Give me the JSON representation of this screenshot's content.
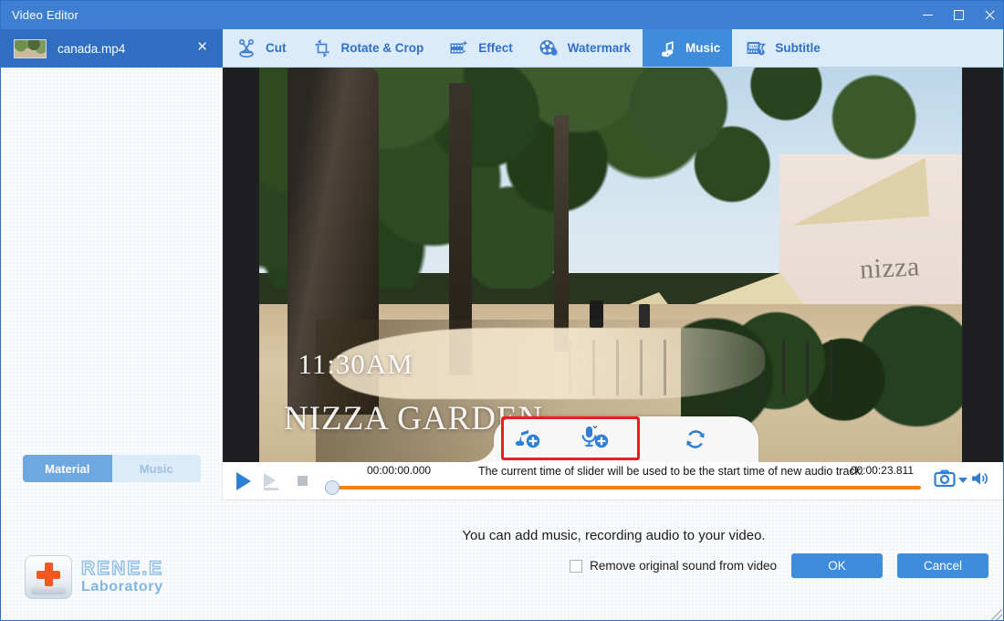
{
  "window": {
    "title": "Video Editor",
    "minimize_label": "Minimize",
    "maximize_label": "Maximize",
    "close_label": "Close"
  },
  "file_tab": {
    "filename": "canada.mp4",
    "close_label": "✕",
    "thumbnail_name": "video-thumbnail"
  },
  "toolbar": {
    "items": [
      {
        "label": "Cut",
        "icon": "scissors-icon",
        "active": false
      },
      {
        "label": "Rotate & Crop",
        "icon": "rotate-crop-icon",
        "active": false
      },
      {
        "label": "Effect",
        "icon": "effect-film-icon",
        "active": false
      },
      {
        "label": "Watermark",
        "icon": "watermark-film-drop-icon",
        "active": false
      },
      {
        "label": "Music",
        "icon": "music-note-icon",
        "active": true
      },
      {
        "label": "Subtitle",
        "icon": "subtitle-icon",
        "active": false
      }
    ]
  },
  "left_panel": {
    "tabs": [
      {
        "label": "Material",
        "active": true
      },
      {
        "label": "Music",
        "active": false
      }
    ]
  },
  "video": {
    "overlay_time": "11:30AM",
    "overlay_place": "NIZZA GARDEN",
    "sign_text": "nizza"
  },
  "audio_actions": {
    "add_music_label": "add-music",
    "add_recording_label": "add-recording",
    "recording_caret": "⌄",
    "refresh_label": "refresh"
  },
  "player": {
    "play_label": "Play",
    "step_label": "Step",
    "stop_label": "Stop",
    "current_time": "00:00:00.000",
    "total_time": "00:00:23.811",
    "hint": "The current time of slider will be used to be the start time of new audio track.",
    "snapshot_icon": "camera-icon",
    "snapshot_menu_icon": "chevron-down-icon",
    "volume_icon": "volume-icon"
  },
  "bottom": {
    "hint": "You can add music, recording audio to your video.",
    "logo_line1": "RENE.E",
    "logo_line2": "Laboratory",
    "checkbox_label": "Remove original sound from video",
    "ok_label": "OK",
    "cancel_label": "Cancel"
  },
  "colors": {
    "title_bar": "#3f7fd1",
    "toolbar_bg": "#dcebfa",
    "accent_blue": "#3f8cdd",
    "slider_orange": "#f08018",
    "highlight_red": "#ee1c1c"
  }
}
